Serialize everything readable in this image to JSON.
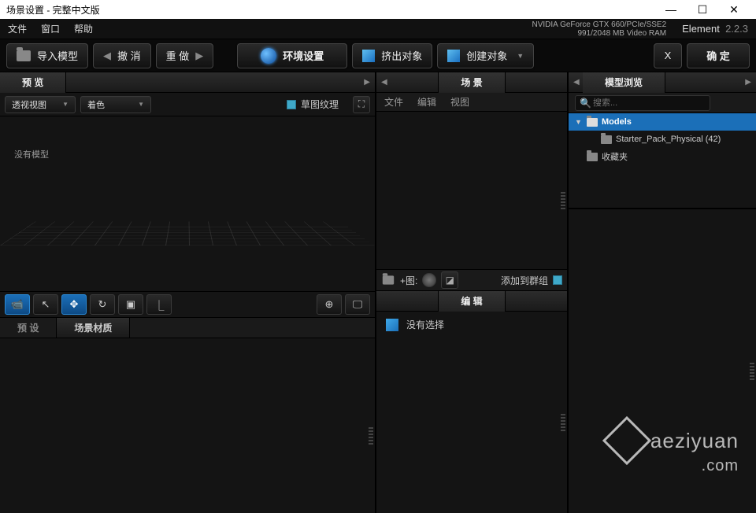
{
  "titlebar": {
    "title": "场景设置 - 完整中文版"
  },
  "window_controls": {
    "min": "—",
    "max": "☐",
    "close": "✕"
  },
  "menubar": {
    "items": [
      "文件",
      "窗口",
      "帮助"
    ],
    "gpu_line1": "NVIDIA GeForce GTX 660/PCIe/SSE2",
    "gpu_line2": "991/2048 MB Video RAM",
    "brand_name": "Element",
    "brand_ver": "2.2.3"
  },
  "toolbar": {
    "import": "导入模型",
    "undo": "撤 消",
    "redo": "重 做",
    "env": "环境设置",
    "extrude": "挤出对象",
    "create": "创建对象",
    "x": "X",
    "ok": "确 定"
  },
  "preview": {
    "tab": "预 览",
    "dd_view": "透视视图",
    "dd_shade": "着色",
    "draft_label": "草图纹理",
    "empty": "没有模型",
    "presets_tab": "预 设",
    "materials_tab": "场景材质"
  },
  "scene": {
    "tab": "场 景",
    "menu": [
      "文件",
      "编辑",
      "视图"
    ],
    "add_label": "+图:",
    "add_group": "添加到群组"
  },
  "edit": {
    "tab": "编 辑",
    "none": "没有选择"
  },
  "browser": {
    "tab": "模型浏览",
    "search_ph": "搜索...",
    "tree": [
      {
        "label": "Models",
        "selected": true,
        "expanded": true,
        "indent": 0
      },
      {
        "label": "Starter_Pack_Physical (42)",
        "selected": false,
        "indent": 1
      },
      {
        "label": "收藏夹",
        "selected": false,
        "indent": 0
      }
    ]
  },
  "watermark": {
    "text": "aeziyuan",
    "sub": ".com"
  }
}
